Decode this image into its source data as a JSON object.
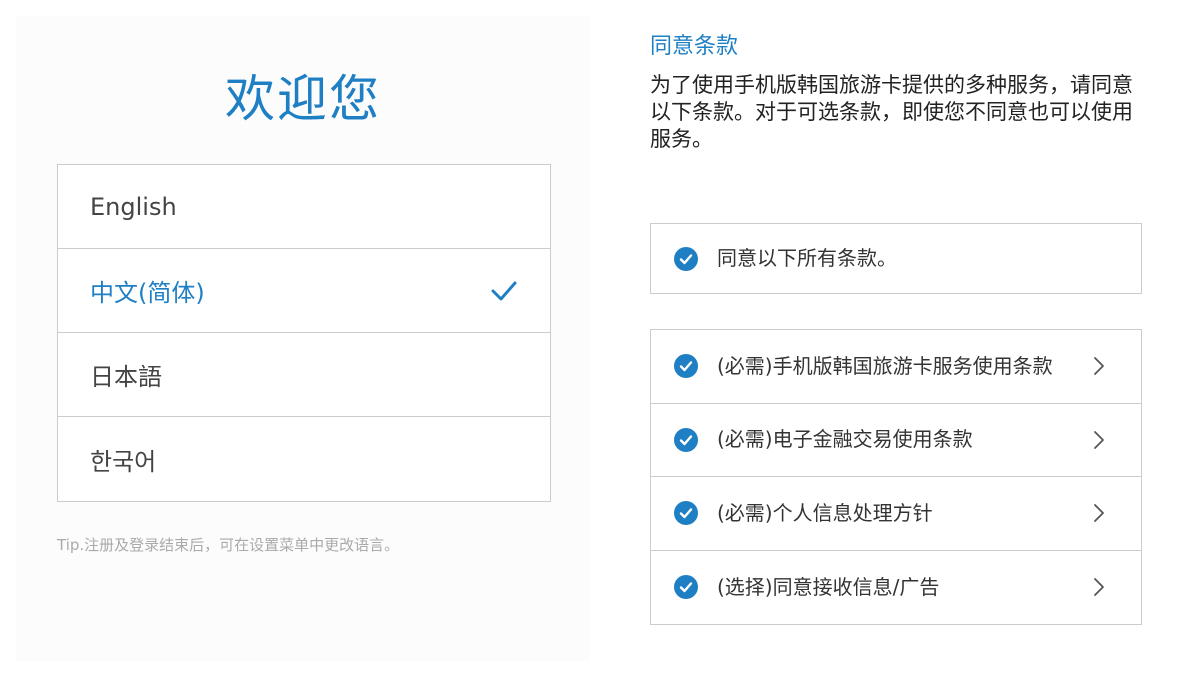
{
  "welcome": {
    "title": "欢迎您"
  },
  "languages": [
    {
      "label": "English",
      "selected": false
    },
    {
      "label": "中文(简体)",
      "selected": true
    },
    {
      "label": "日本語",
      "selected": false
    },
    {
      "label": "한국어",
      "selected": false
    }
  ],
  "tip": "Tip.注册及登录结束后，可在设置菜单中更改语言。",
  "terms": {
    "title": "同意条款",
    "description": "为了使用手机版韩国旅游卡提供的多种服务，请同意以下条款。对于可选条款，即使您不同意也可以使用服务。",
    "agree_all": {
      "label": "同意以下所有条款。",
      "checked": true
    },
    "items": [
      {
        "label": "(必需)手机版韩国旅游卡服务使用条款",
        "checked": true
      },
      {
        "label": "(必需)电子金融交易使用条款",
        "checked": true
      },
      {
        "label": "(必需)个人信息处理方针",
        "checked": true
      },
      {
        "label": "(选择)同意接收信息/广告",
        "checked": true
      }
    ]
  },
  "icons": {
    "selected_check": "check-icon",
    "term_check": "check-circle-icon",
    "term_detail": "chevron-right-icon"
  },
  "colors": {
    "accent": "#1f7fc4",
    "border": "#cccccc",
    "tip_text": "#aaaaaa"
  }
}
